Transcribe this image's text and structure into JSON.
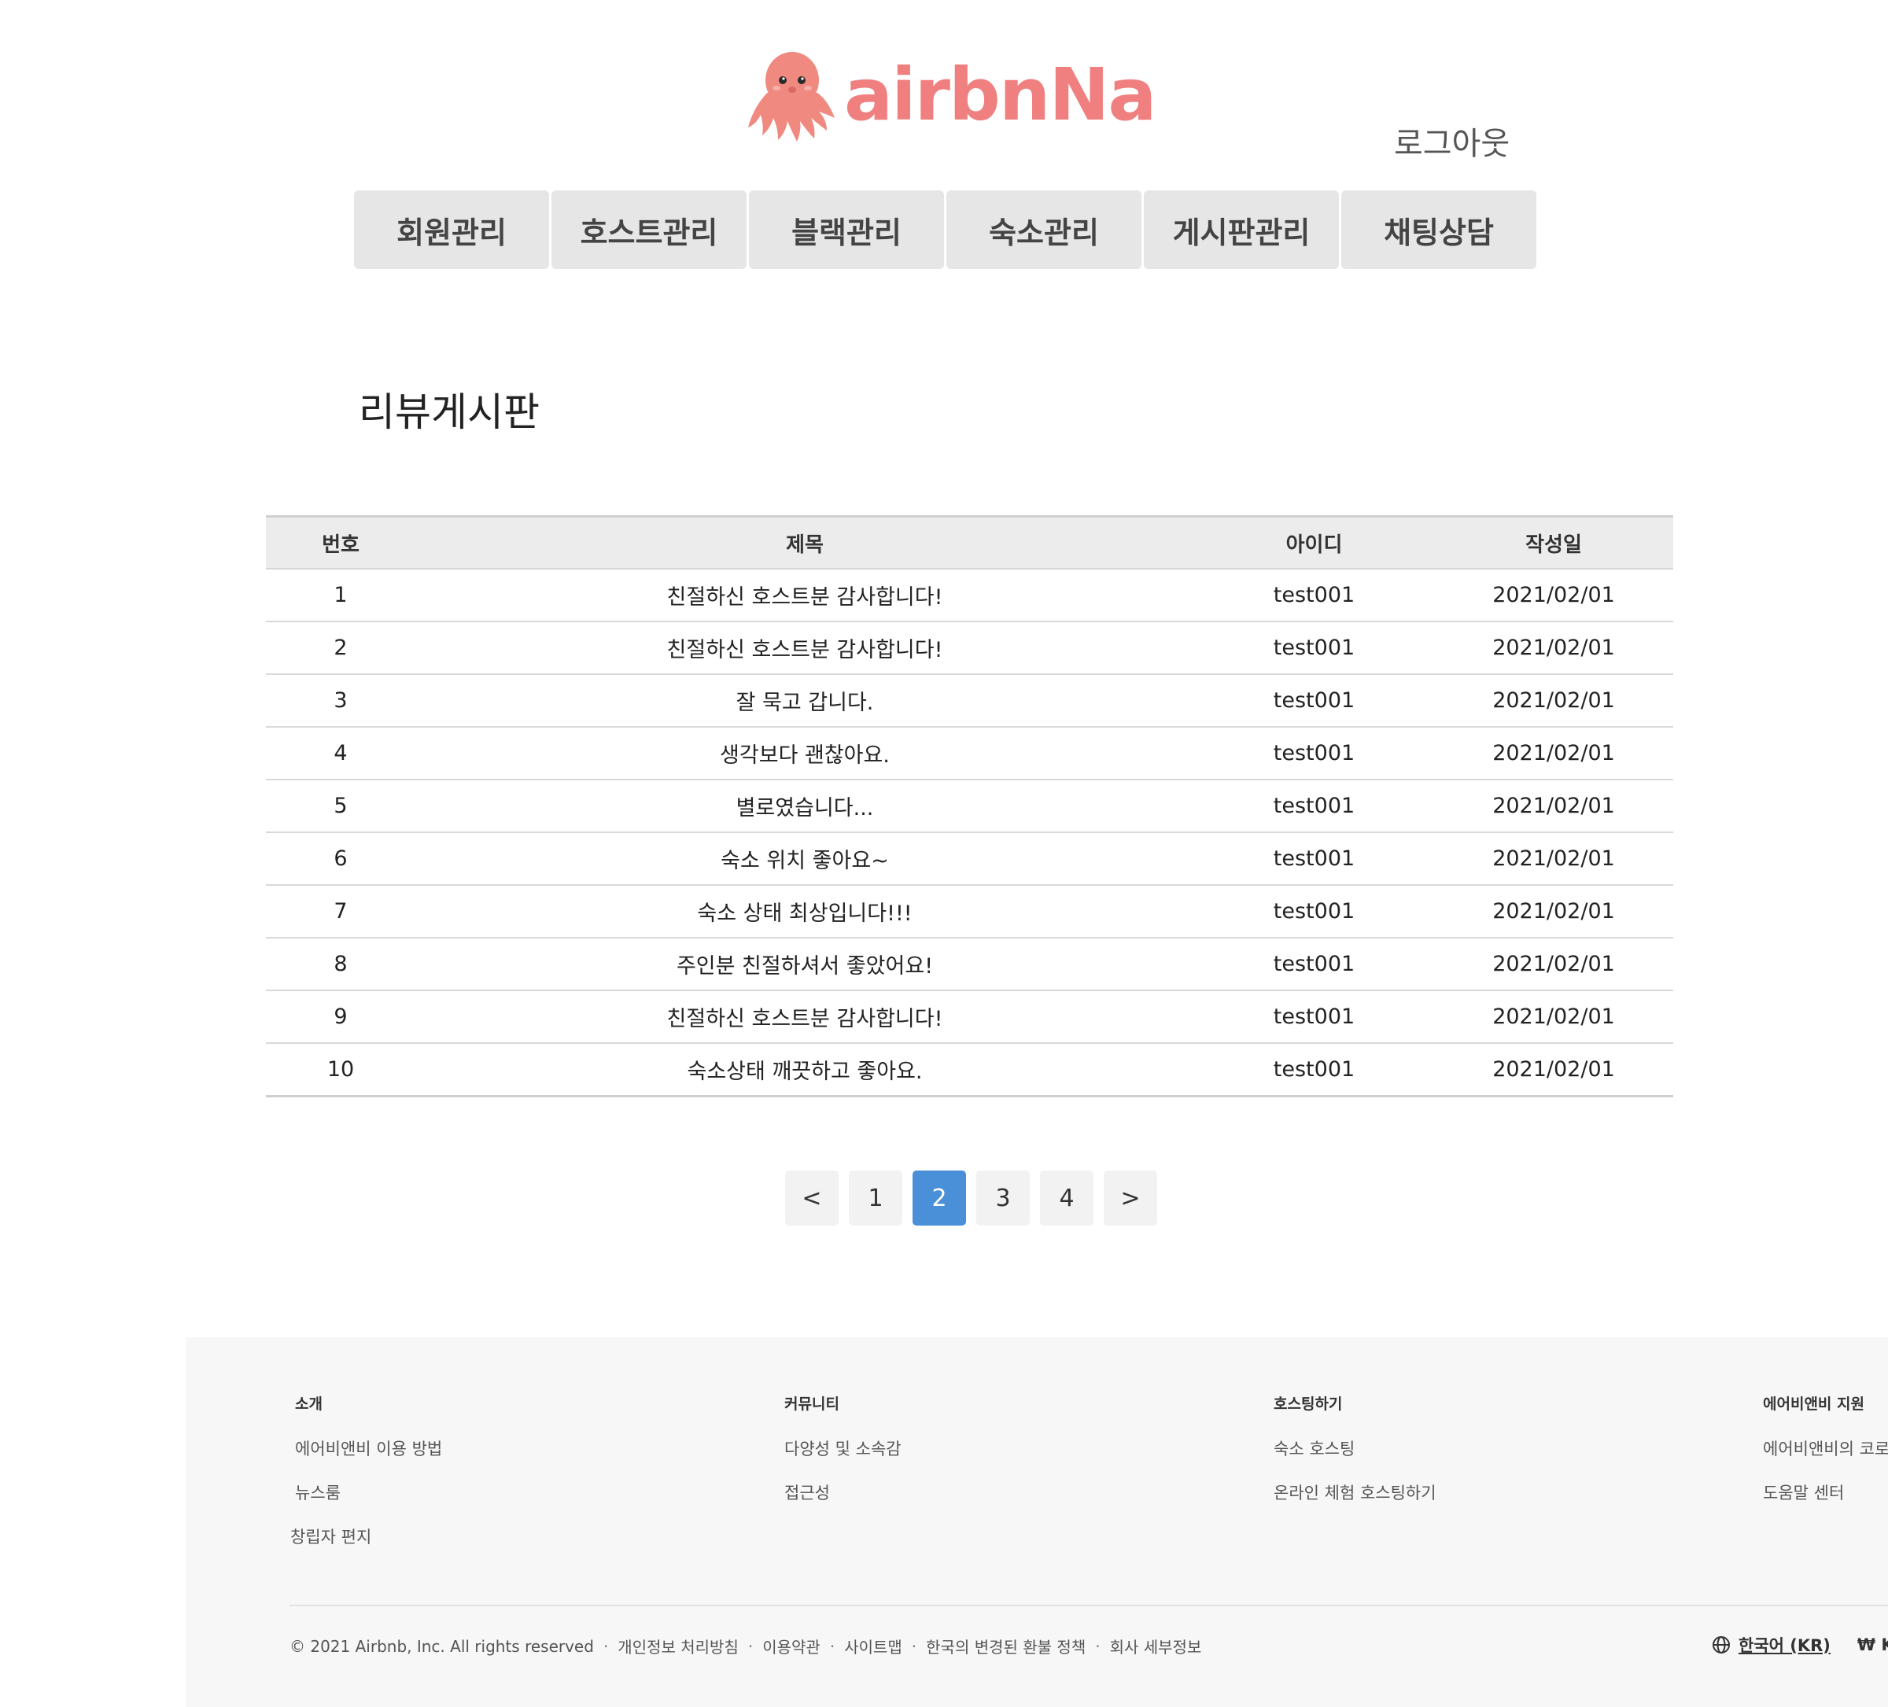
{
  "header": {
    "logo_text": "airbnNa",
    "logout_label": "로그아웃"
  },
  "nav": {
    "items": [
      {
        "label": "회원관리"
      },
      {
        "label": "호스트관리"
      },
      {
        "label": "블랙관리"
      },
      {
        "label": "숙소관리"
      },
      {
        "label": "게시판관리"
      },
      {
        "label": "채팅상담"
      }
    ]
  },
  "page": {
    "title": "리뷰게시판"
  },
  "table": {
    "columns": [
      "번호",
      "제목",
      "아이디",
      "작성일"
    ],
    "rows": [
      {
        "no": "1",
        "title": "친절하신 호스트분 감사합니다!",
        "id": "test001",
        "date": "2021/02/01"
      },
      {
        "no": "2",
        "title": "친절하신 호스트분 감사합니다!",
        "id": "test001",
        "date": "2021/02/01"
      },
      {
        "no": "3",
        "title": "잘 묵고 갑니다.",
        "id": "test001",
        "date": "2021/02/01"
      },
      {
        "no": "4",
        "title": "생각보다 괜찮아요.",
        "id": "test001",
        "date": "2021/02/01"
      },
      {
        "no": "5",
        "title": "별로였습니다...",
        "id": "test001",
        "date": "2021/02/01"
      },
      {
        "no": "6",
        "title": "숙소 위치 좋아요~",
        "id": "test001",
        "date": "2021/02/01"
      },
      {
        "no": "7",
        "title": "숙소 상태 최상입니다!!!",
        "id": "test001",
        "date": "2021/02/01"
      },
      {
        "no": "8",
        "title": "주인분 친절하셔서 좋았어요!",
        "id": "test001",
        "date": "2021/02/01"
      },
      {
        "no": "9",
        "title": "친절하신 호스트분 감사합니다!",
        "id": "test001",
        "date": "2021/02/01"
      },
      {
        "no": "10",
        "title": "숙소상태 깨끗하고 좋아요.",
        "id": "test001",
        "date": "2021/02/01"
      }
    ]
  },
  "pagination": {
    "prev_label": "<",
    "next_label": ">",
    "pages": [
      "1",
      "2",
      "3",
      "4"
    ],
    "current": "2",
    "active_color": "#4a90d9"
  },
  "footer": {
    "columns": [
      {
        "heading": "소개",
        "links": [
          "에어비앤비 이용 방법",
          "뉴스룸",
          "창립자 편지"
        ]
      },
      {
        "heading": "커뮤니티",
        "links": [
          "다양성 및 소속감",
          "접근성"
        ]
      },
      {
        "heading": "호스팅하기",
        "links": [
          "숙소 호스팅",
          "온라인 체험 호스팅하기"
        ]
      },
      {
        "heading": "에어비앤비 지원",
        "links": [
          "에어비앤비의 코로",
          "도움말 센터"
        ]
      }
    ],
    "copyright": "© 2021 Airbnb, Inc. All rights reserved",
    "legal_links": [
      "개인정보 처리방침",
      "이용약관",
      "사이트맵",
      "한국의 변경된 환불 정책",
      "회사 세부정보"
    ],
    "separator": "·",
    "language": "한국어 (KR)",
    "currency": "₩ K",
    "globe_icon": "globe-icon"
  },
  "colors": {
    "brand": "#f08080",
    "nav_bg": "#e6e6e6",
    "header_row_bg": "#ececec",
    "footer_bg": "#f7f7f7"
  }
}
